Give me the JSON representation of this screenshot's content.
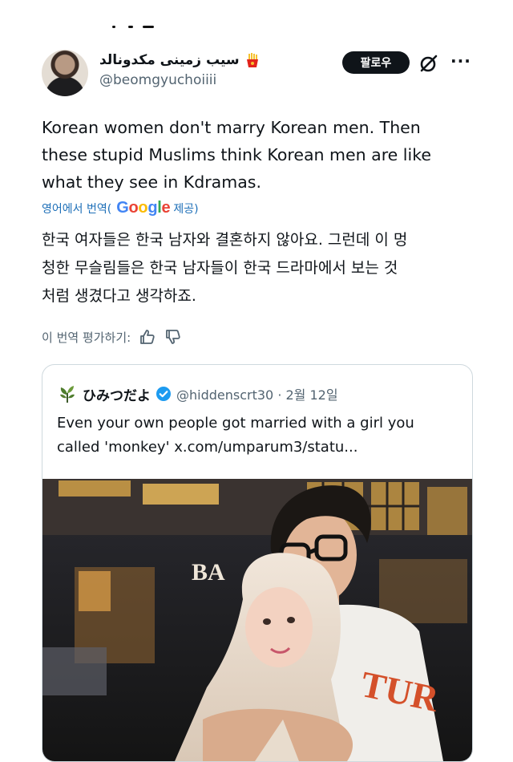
{
  "author": {
    "display_name": "سیب زمینی مکدونالد",
    "handle": "@beomgyuchoiiii"
  },
  "actions": {
    "follow_label": "팔로우",
    "more_label": "···"
  },
  "tweet": {
    "lines": [
      "Korean women don't marry Korean men. Then",
      "these stupid Muslims think Korean men are like",
      "what they see in Kdramas."
    ]
  },
  "translation": {
    "prefix": "영어에서 번역(",
    "provider": "Google",
    "suffix": " 제공)",
    "lines": [
      "한국 여자들은 한국 남자와 결혼하지 않아요. 그런데 이 멍",
      "청한 무슬림들은 한국 남자들이 한국 드라마에서 보는 것",
      "처럼 생겼다고 생각하죠."
    ],
    "rate_label": "이 번역 평가하기:"
  },
  "quote": {
    "name": "ひみつだよ",
    "handle_date": "@hiddenscrt30 · 2월 12일",
    "lines": [
      "Even your own people got married with a girl you",
      "called 'monkey'  x.com/umparum3/statu..."
    ],
    "photo_sign_text": "BA"
  },
  "colors": {
    "link_blue": "#1d6fb8",
    "verified_blue": "#1d9bf0",
    "muted_gray": "#536471",
    "border": "#cfd9de",
    "button_black": "#0f1419"
  },
  "icons": [
    "fries-emoji-icon",
    "grok-icon",
    "more-icon",
    "thumbs-up-icon",
    "thumbs-down-icon",
    "plant-avatar-icon",
    "verified-badge-icon"
  ]
}
